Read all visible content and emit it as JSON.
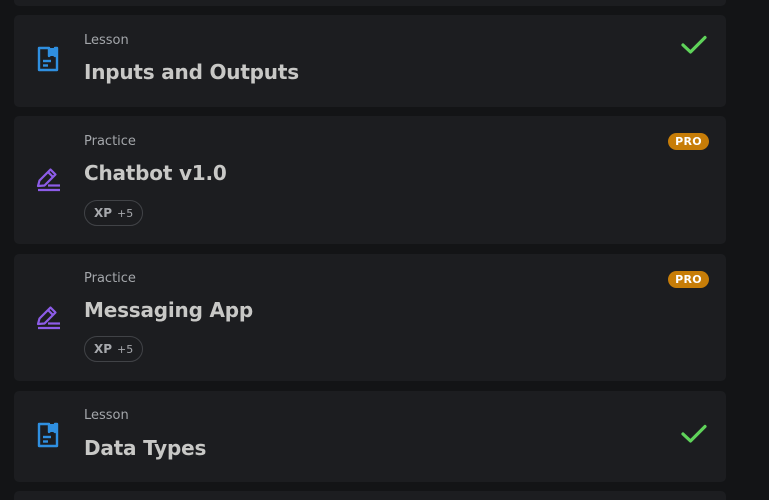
{
  "colors": {
    "page_background": "#131416",
    "card_background": "#1c1d20",
    "lesson_icon": "#2f8fe0",
    "practice_icon": "#8d5ce8",
    "check": "#5fd35a",
    "pro_badge": "#c77d08"
  },
  "items": [
    {
      "type_label": "Lesson",
      "title": "Inputs and Outputs",
      "icon": "document-icon",
      "status": "completed",
      "status_icon": "checkmark-icon"
    },
    {
      "type_label": "Practice",
      "title": "Chatbot v1.0",
      "icon": "edit-pencil-icon",
      "badge": "PRO",
      "xp_label": "XP",
      "xp_value": "+5"
    },
    {
      "type_label": "Practice",
      "title": "Messaging App",
      "icon": "edit-pencil-icon",
      "badge": "PRO",
      "xp_label": "XP",
      "xp_value": "+5"
    },
    {
      "type_label": "Lesson",
      "title": "Data Types",
      "icon": "document-icon",
      "status": "completed",
      "status_icon": "checkmark-icon"
    }
  ]
}
